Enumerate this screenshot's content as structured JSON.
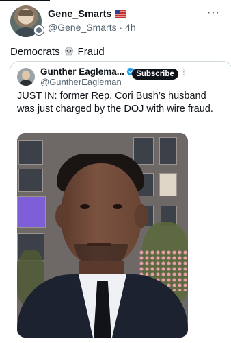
{
  "tweet": {
    "author_name": "Gene_Smarts",
    "author_handle": "@Gene_Smarts",
    "separator": "·",
    "timestamp": "4h",
    "more_label": "···",
    "text_before": "Democrats",
    "emoji": "skull-emoji",
    "text_after": "Fraud"
  },
  "quote": {
    "author_name": "Gunther Eaglema...",
    "author_handle": "@GuntherEagleman",
    "subscribe_label": "Subscribe",
    "more_label": "⋮",
    "text": "JUST IN:  former Rep. Cori Bush’s husband was just charged by the DOJ with wire fraud."
  },
  "colors": {
    "text": "#0f1419",
    "secondary_text": "#536471",
    "verified": "#1d9bf0",
    "subscribe_bg": "#0f1419",
    "border": "#cfd9de"
  }
}
